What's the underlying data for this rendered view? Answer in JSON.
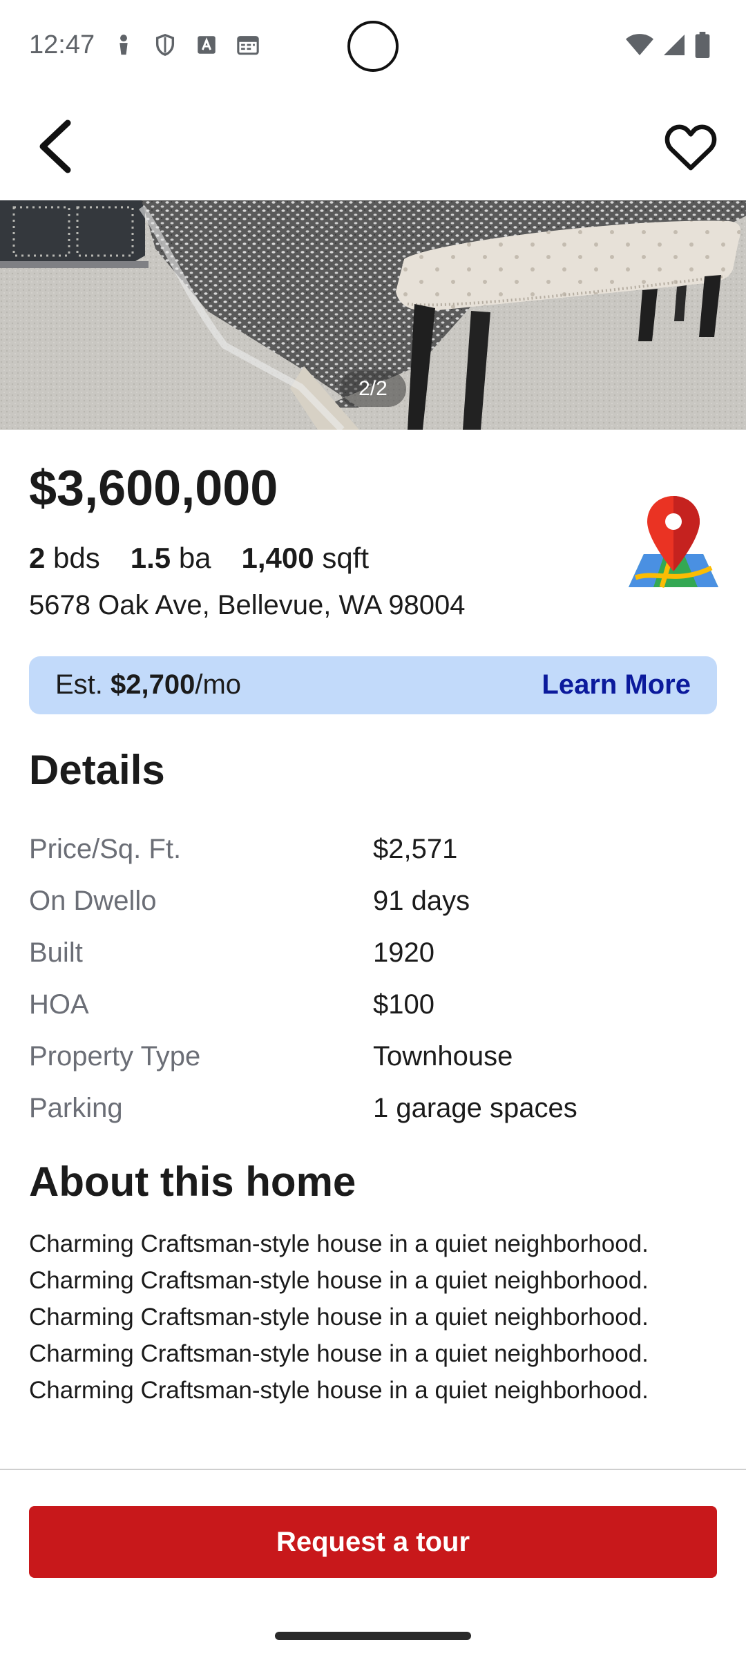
{
  "status_bar": {
    "time": "12:47",
    "left_icons": [
      "person-icon",
      "shield-icon",
      "font-download-icon",
      "calendar-icon"
    ],
    "right_icons": [
      "wifi-icon",
      "signal-icon",
      "battery-icon"
    ]
  },
  "app_bar": {
    "back_icon": "chevron-left-icon",
    "favorite_icon": "heart-outline-icon"
  },
  "gallery": {
    "counter": "2/2"
  },
  "listing": {
    "price": "$3,600,000",
    "beds_value": "2",
    "beds_unit": "bds",
    "baths_value": "1.5",
    "baths_unit": "ba",
    "sqft_value": "1,400",
    "sqft_unit": "sqft",
    "address": "5678 Oak Ave, Bellevue, WA 98004",
    "map_icon": "map-pin-icon"
  },
  "mortgage": {
    "prefix": "Est. ",
    "amount": "$2,700",
    "suffix": "/mo",
    "link_label": "Learn More"
  },
  "details": {
    "title": "Details",
    "rows": [
      {
        "label": "Price/Sq. Ft.",
        "value": "$2,571"
      },
      {
        "label": "On Dwello",
        "value": "91 days"
      },
      {
        "label": "Built",
        "value": "1920"
      },
      {
        "label": "HOA",
        "value": "$100"
      },
      {
        "label": "Property Type",
        "value": "Townhouse"
      },
      {
        "label": "Parking",
        "value": "1 garage spaces"
      }
    ]
  },
  "about": {
    "title": "About this home",
    "description": "Charming Craftsman-style house in a quiet neighborhood. Charming Craftsman-style house in a quiet neighborhood. Charming Craftsman-style house in a quiet neighborhood. Charming Craftsman-style house in a quiet neighborhood. Charming Craftsman-style house in a quiet neighborhood."
  },
  "actions": {
    "tour_label": "Request a tour"
  },
  "colors": {
    "accent_red": "#c8181b",
    "mortgage_bg": "#c2dafa",
    "link_blue": "#0b1a9c"
  }
}
